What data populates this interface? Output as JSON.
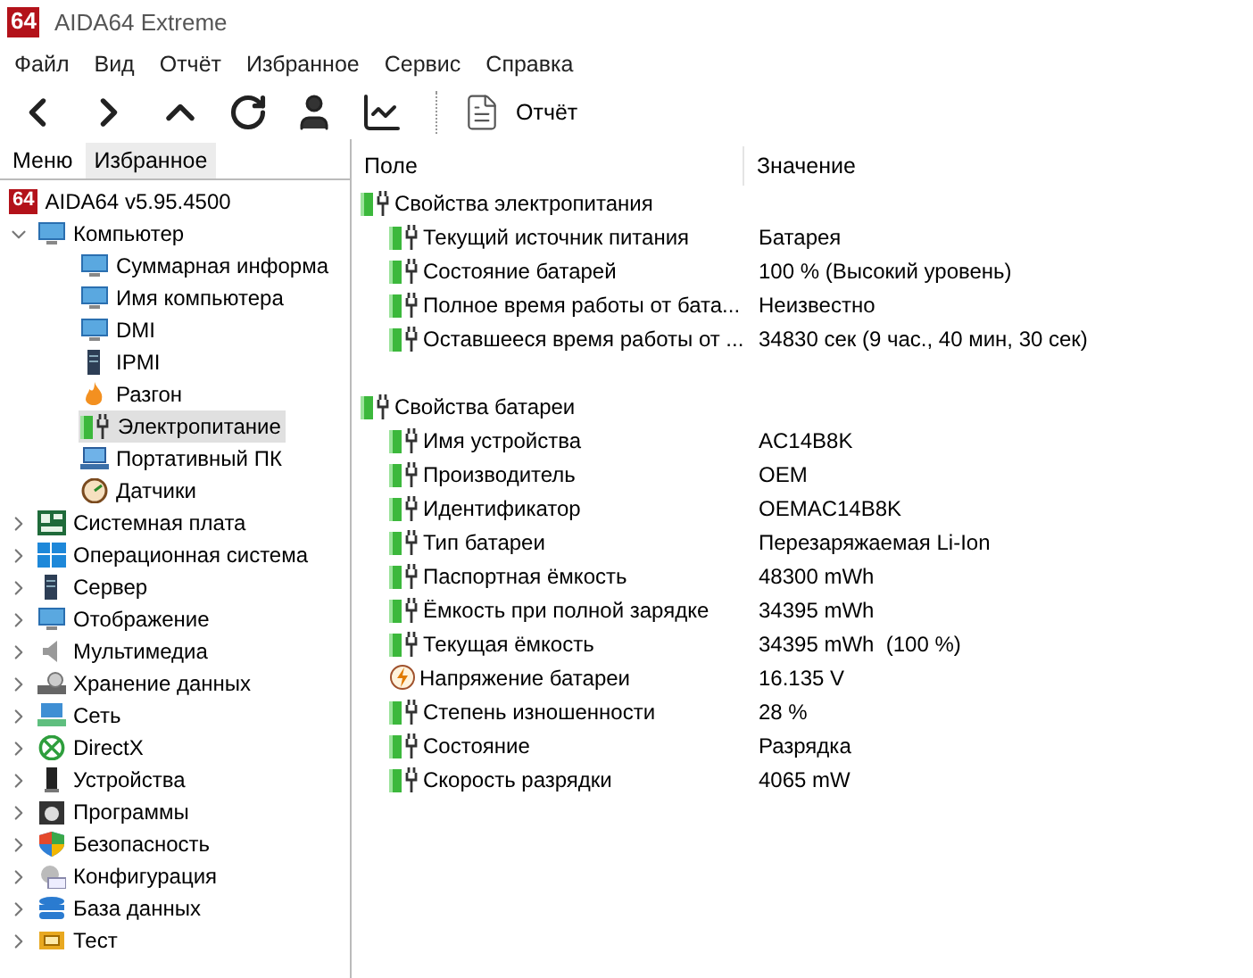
{
  "window": {
    "title": "AIDA64 Extreme",
    "logo": "64"
  },
  "menu": [
    "Файл",
    "Вид",
    "Отчёт",
    "Избранное",
    "Сервис",
    "Справка"
  ],
  "toolbar": {
    "report_button": "Отчёт"
  },
  "sidebar": {
    "tabs": [
      {
        "label": "Меню",
        "selected": true
      },
      {
        "label": "Избранное",
        "selected": false
      }
    ],
    "root": {
      "logo": "64",
      "label": "AIDA64 v5.95.4500"
    },
    "tree": [
      {
        "label": "Компьютер",
        "expanded": true,
        "selected": false,
        "children": [
          {
            "label": "Суммарная информа",
            "selected": false
          },
          {
            "label": "Имя компьютера",
            "selected": false
          },
          {
            "label": "DMI",
            "selected": false
          },
          {
            "label": "IPMI",
            "selected": false
          },
          {
            "label": "Разгон",
            "selected": false
          },
          {
            "label": "Электропитание",
            "selected": true
          },
          {
            "label": "Портативный ПК",
            "selected": false
          },
          {
            "label": "Датчики",
            "selected": false
          }
        ]
      },
      {
        "label": "Системная плата",
        "expanded": false,
        "selected": false
      },
      {
        "label": "Операционная система",
        "expanded": false,
        "selected": false
      },
      {
        "label": "Сервер",
        "expanded": false,
        "selected": false
      },
      {
        "label": "Отображение",
        "expanded": false,
        "selected": false
      },
      {
        "label": "Мультимедиа",
        "expanded": false,
        "selected": false
      },
      {
        "label": "Хранение данных",
        "expanded": false,
        "selected": false
      },
      {
        "label": "Сеть",
        "expanded": false,
        "selected": false
      },
      {
        "label": "DirectX",
        "expanded": false,
        "selected": false
      },
      {
        "label": "Устройства",
        "expanded": false,
        "selected": false
      },
      {
        "label": "Программы",
        "expanded": false,
        "selected": false
      },
      {
        "label": "Безопасность",
        "expanded": false,
        "selected": false
      },
      {
        "label": "Конфигурация",
        "expanded": false,
        "selected": false
      },
      {
        "label": "База данных",
        "expanded": false,
        "selected": false
      },
      {
        "label": "Тест",
        "expanded": false,
        "selected": false
      }
    ]
  },
  "table": {
    "columns": [
      "Поле",
      "Значение"
    ],
    "sections": [
      {
        "title": "Свойства электропитания",
        "rows": [
          {
            "kind": "power",
            "field": "Текущий источник питания",
            "value": "Батарея"
          },
          {
            "kind": "power",
            "field": "Состояние батарей",
            "value": "100 % (Высокий уровень)"
          },
          {
            "kind": "power",
            "field": "Полное время работы от бата...",
            "value": "Неизвестно"
          },
          {
            "kind": "power",
            "field": "Оставшееся время работы от ...",
            "value": "34830 сек (9 час., 40 мин, 30 сек)"
          }
        ]
      },
      {
        "title": "Свойства батареи",
        "rows": [
          {
            "kind": "power",
            "field": "Имя устройства",
            "value": "AC14B8K"
          },
          {
            "kind": "power",
            "field": "Производитель",
            "value": "OEM"
          },
          {
            "kind": "power",
            "field": "Идентификатор",
            "value": "OEMAC14B8K"
          },
          {
            "kind": "power",
            "field": "Тип батареи",
            "value": "Перезаряжаемая Li-Ion"
          },
          {
            "kind": "power",
            "field": "Паспортная ёмкость",
            "value": "48300 mWh"
          },
          {
            "kind": "power",
            "field": "Ёмкость при полной зарядке",
            "value": "34395 mWh"
          },
          {
            "kind": "power",
            "field": "Текущая ёмкость",
            "value": "34395 mWh  (100 %)"
          },
          {
            "kind": "voltage",
            "field": "Напряжение батареи",
            "value": "16.135 V"
          },
          {
            "kind": "power",
            "field": "Степень изношенности",
            "value": "28 %"
          },
          {
            "kind": "power",
            "field": "Состояние",
            "value": "Разрядка"
          },
          {
            "kind": "power",
            "field": "Скорость разрядки",
            "value": "4065 mW"
          }
        ]
      }
    ]
  }
}
